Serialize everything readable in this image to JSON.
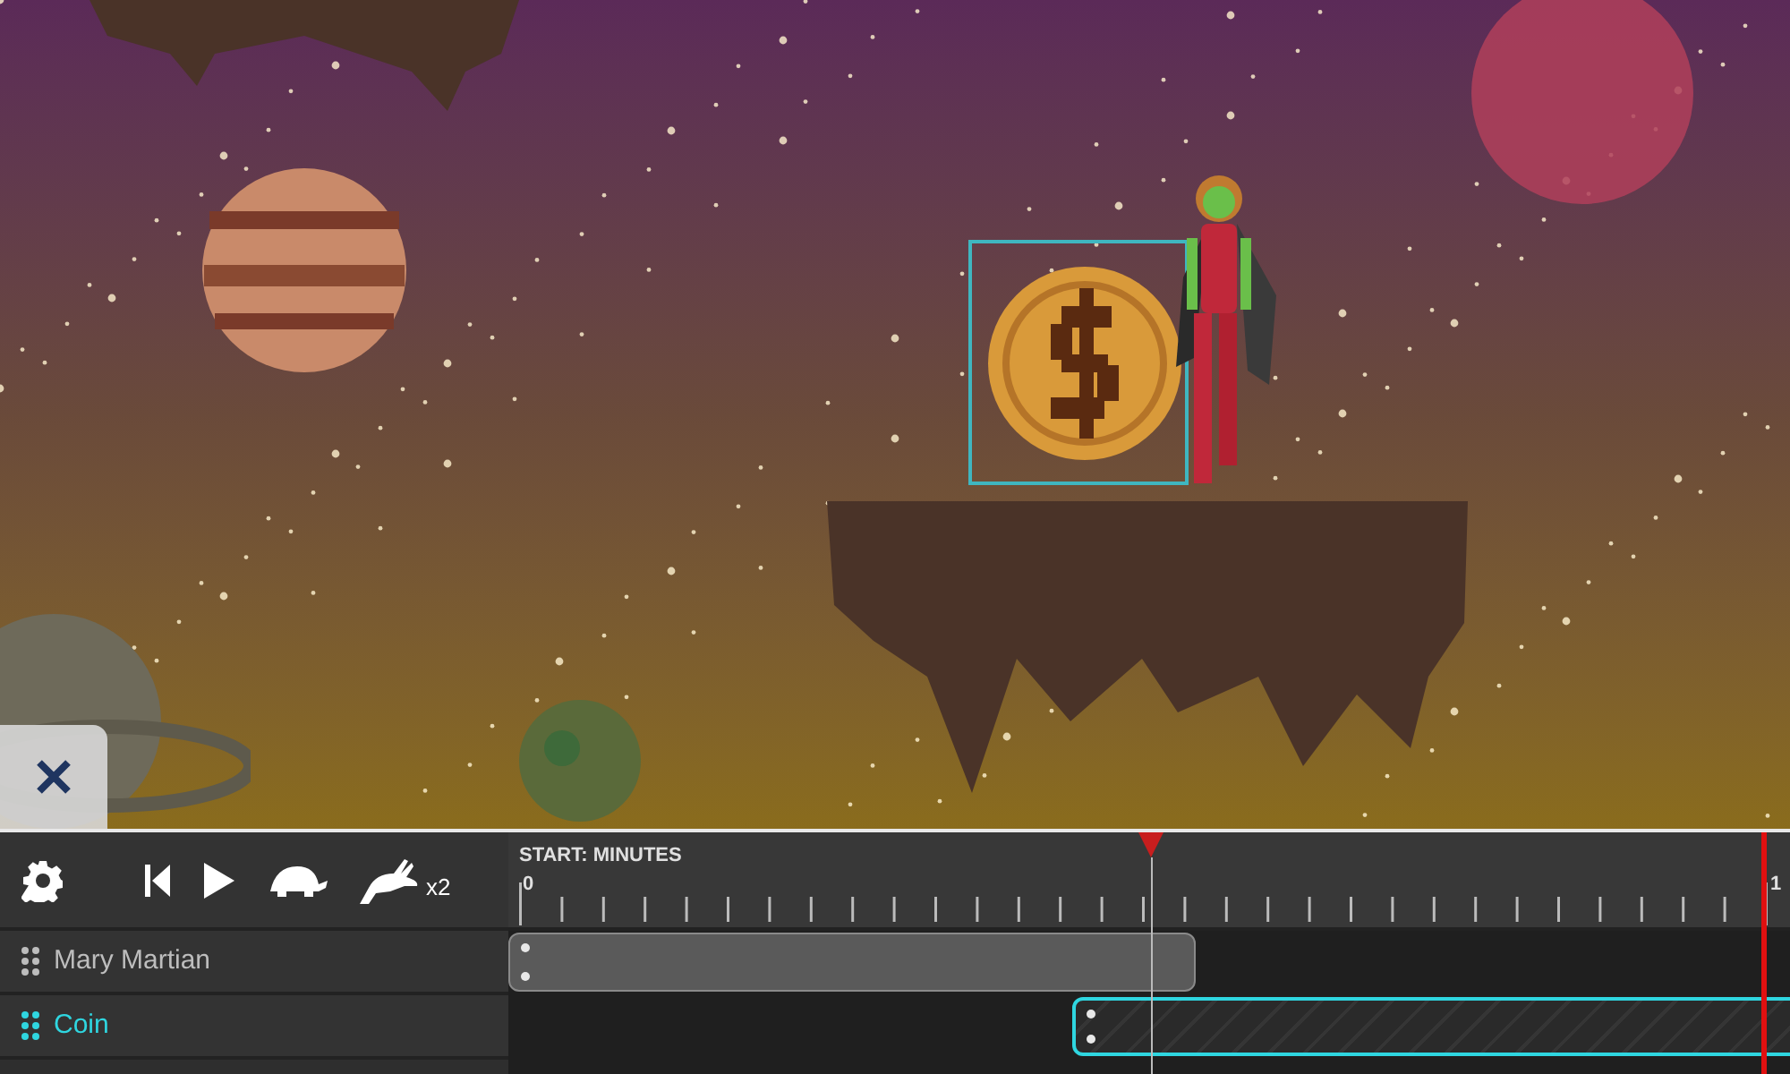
{
  "toolbar": {
    "speed_label": "x2"
  },
  "ruler": {
    "title": "START: MINUTES",
    "start_label": "0",
    "end_label": "1"
  },
  "tracks": [
    {
      "name": "Mary Martian",
      "selected": false
    },
    {
      "name": "Coin",
      "selected": true
    }
  ]
}
